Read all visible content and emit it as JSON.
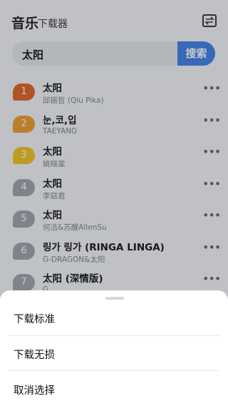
{
  "header": {
    "title": "音乐",
    "subtitle": "下载器",
    "swap_icon": "swap-arrows-icon"
  },
  "search": {
    "value": "太阳",
    "button_label": "搜索"
  },
  "results": [
    {
      "rank": "1",
      "badge_color": "#e2621f",
      "title": "太阳",
      "artist": "邱振哲 (Qiu Pika)",
      "more": "•••"
    },
    {
      "rank": "2",
      "badge_color": "#f19a27",
      "title": "눈,코,입",
      "artist": "TAEYANG",
      "more": "•••"
    },
    {
      "rank": "3",
      "badge_color": "#f2c31b",
      "title": "太阳",
      "artist": "姚晓棠",
      "more": "•••"
    },
    {
      "rank": "4",
      "badge_color": "#9ea3a8",
      "title": "太阳",
      "artist": "李窈君",
      "more": "•••"
    },
    {
      "rank": "5",
      "badge_color": "#9ea3a8",
      "title": "太阳",
      "artist": "何洁&苏醒AllenSu",
      "more": "•••"
    },
    {
      "rank": "6",
      "badge_color": "#9ea3a8",
      "title": "링가 링가 (RINGA LINGA)",
      "artist": "G-DRAGON&太阳",
      "more": "•••"
    },
    {
      "rank": "7",
      "badge_color": "#9ea3a8",
      "title": "太阳 (深情版)",
      "artist": "G...",
      "more": "•••"
    }
  ],
  "sheet": {
    "options": [
      {
        "label": "下载标准"
      },
      {
        "label": "下载无损"
      },
      {
        "label": "取消选择"
      }
    ]
  }
}
